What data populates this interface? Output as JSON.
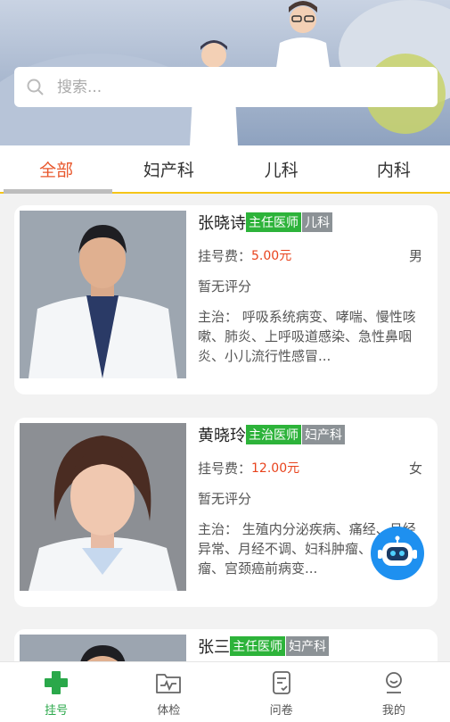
{
  "search": {
    "placeholder": "搜索..."
  },
  "tabs": [
    {
      "label": "全部",
      "active": true
    },
    {
      "label": "妇产科",
      "active": false
    },
    {
      "label": "儿科",
      "active": false
    },
    {
      "label": "内科",
      "active": false
    }
  ],
  "doctors": [
    {
      "name": "张晓诗",
      "title": "主任医师",
      "dept": "儿科",
      "fee_label": "挂号费：",
      "fee": "5.00元",
      "gender": "男",
      "rating": "暂无评分",
      "desc": "主治： 呼吸系统病变、哮喘、慢性咳嗽、肺炎、上呼吸道感染、急性鼻咽炎、小儿流行性感冒..."
    },
    {
      "name": "黄晓玲",
      "title": "主治医师",
      "dept": "妇产科",
      "fee_label": "挂号费：",
      "fee": "12.00元",
      "gender": "女",
      "rating": "暂无评分",
      "desc": "主治： 生殖内分泌疾病、痛经、月经异常、月经不调、妇科肿瘤、子宫肌瘤、宫颈癌前病变..."
    },
    {
      "name": "张三",
      "title": "主任医师",
      "dept": "妇产科"
    }
  ],
  "nav": [
    {
      "label": "挂号",
      "icon": "plus-cross-icon",
      "active": true
    },
    {
      "label": "体检",
      "icon": "health-folder-icon",
      "active": false
    },
    {
      "label": "问卷",
      "icon": "checklist-icon",
      "active": false
    },
    {
      "label": "我的",
      "icon": "user-icon",
      "active": false
    }
  ],
  "colors": {
    "accent": "#e8572c",
    "green": "#2db33a",
    "fee": "#e8431d",
    "robot": "#1e90f0",
    "tab_underline": "#f5c518"
  }
}
